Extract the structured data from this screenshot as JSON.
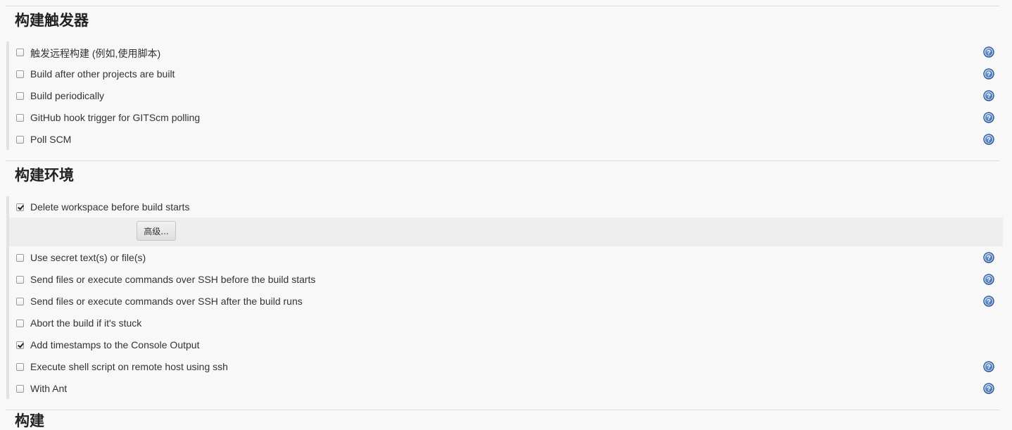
{
  "build_triggers": {
    "title": "构建触发器",
    "options": [
      {
        "label": "触发远程构建 (例如,使用脚本)",
        "checked": false,
        "help": true
      },
      {
        "label": "Build after other projects are built",
        "checked": false,
        "help": true
      },
      {
        "label": "Build periodically",
        "checked": false,
        "help": true
      },
      {
        "label": "GitHub hook trigger for GITScm polling",
        "checked": false,
        "help": true
      },
      {
        "label": "Poll SCM",
        "checked": false,
        "help": true
      }
    ]
  },
  "build_environment": {
    "title": "构建环境",
    "advanced_button": "高级...",
    "options": [
      {
        "label": "Delete workspace before build starts",
        "checked": true,
        "help": false
      },
      {
        "label": "Use secret text(s) or file(s)",
        "checked": false,
        "help": true
      },
      {
        "label": "Send files or execute commands over SSH before the build starts",
        "checked": false,
        "help": true
      },
      {
        "label": "Send files or execute commands over SSH after the build runs",
        "checked": false,
        "help": true
      },
      {
        "label": "Abort the build if it's stuck",
        "checked": false,
        "help": false
      },
      {
        "label": "Add timestamps to the Console Output",
        "checked": true,
        "help": false
      },
      {
        "label": "Execute shell script on remote host using ssh",
        "checked": false,
        "help": true
      },
      {
        "label": "With Ant",
        "checked": false,
        "help": true
      }
    ]
  },
  "next_section": {
    "title": "构建"
  },
  "icons": {
    "help": "help-icon",
    "checkbox": "checkbox-icon"
  },
  "colors": {
    "help_icon": "#3e6db0",
    "background": "#f8f8f8"
  }
}
